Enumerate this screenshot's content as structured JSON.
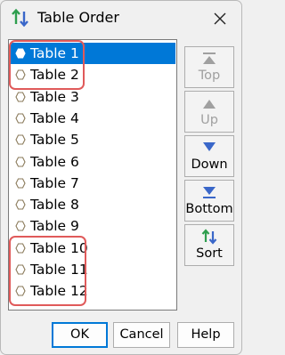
{
  "window": {
    "title": "Table Order",
    "icon": "sort-arrows-icon",
    "close_icon": "close-icon"
  },
  "list": {
    "items": [
      {
        "label": "Table 1",
        "selected": true,
        "highlighted": true
      },
      {
        "label": "Table 2",
        "selected": false,
        "highlighted": true
      },
      {
        "label": "Table 3",
        "selected": false,
        "highlighted": false
      },
      {
        "label": "Table 4",
        "selected": false,
        "highlighted": false
      },
      {
        "label": "Table 5",
        "selected": false,
        "highlighted": false
      },
      {
        "label": "Table 6",
        "selected": false,
        "highlighted": false
      },
      {
        "label": "Table 7",
        "selected": false,
        "highlighted": false
      },
      {
        "label": "Table 8",
        "selected": false,
        "highlighted": false
      },
      {
        "label": "Table 9",
        "selected": false,
        "highlighted": false
      },
      {
        "label": "Table 10",
        "selected": false,
        "highlighted": true
      },
      {
        "label": "Table 11",
        "selected": false,
        "highlighted": true
      },
      {
        "label": "Table 12",
        "selected": false,
        "highlighted": true
      }
    ],
    "item_icon": "table-node-icon"
  },
  "side_buttons": {
    "top": {
      "label": "Top",
      "icon": "move-to-top-icon",
      "enabled": false
    },
    "up": {
      "label": "Up",
      "icon": "move-up-icon",
      "enabled": false
    },
    "down": {
      "label": "Down",
      "icon": "move-down-icon",
      "enabled": true
    },
    "bottom": {
      "label": "Bottom",
      "icon": "move-to-bottom-icon",
      "enabled": true
    },
    "sort": {
      "label": "Sort",
      "icon": "sort-arrows-icon",
      "enabled": true
    }
  },
  "footer": {
    "ok_label": "OK",
    "cancel_label": "Cancel",
    "help_label": "Help"
  },
  "colors": {
    "selection": "#0078d7",
    "highlight": "#e05a5a",
    "arrow_blue": "#3a67c9",
    "arrow_green": "#2e9e4e",
    "disabled": "#a0a0a0"
  }
}
